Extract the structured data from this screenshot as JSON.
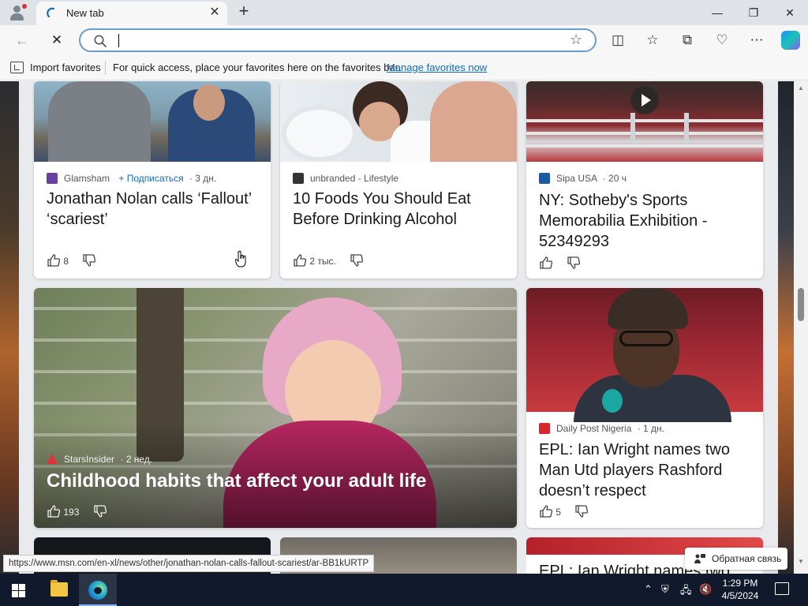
{
  "browser": {
    "tab_title": "New tab",
    "address_value": "",
    "favorites_bar": {
      "import_label": "Import favorites",
      "hint_text": "For quick access, place your favorites here on the favorites bar.",
      "manage_link": "Manage favorites now"
    },
    "status_url": "https://www.msn.com/en-xl/news/other/jonathan-nolan-calls-fallout-scariest/ar-BB1kURTP"
  },
  "feed": {
    "cards": [
      {
        "source": "Glamsham",
        "subscribe": "+ Подписаться",
        "age": "· 3 дн.",
        "title": "Jonathan Nolan calls ‘Fallout’ ‘scariest’",
        "likes": "8",
        "source_color": "#6a3fa0"
      },
      {
        "source": "unbranded - Lifestyle",
        "age": "",
        "title": "10 Foods You Should Eat Before Drinking Alcohol",
        "likes": "2 тыс.",
        "source_color": "#333333"
      },
      {
        "source": "Sipa USA",
        "age": "· 20 ч",
        "title": "NY: Sotheby's Sports Memorabilia Exhibition - 52349293",
        "likes": "",
        "source_color": "#1c5aa8"
      }
    ],
    "hero": {
      "source": "StarsInsider",
      "age": "· 2 нед.",
      "title": "Childhood habits that affect your adult life",
      "likes": "193",
      "source_color": "#e0333c"
    },
    "side": {
      "source": "Daily Post Nigeria",
      "age": "· 1 дн.",
      "title": "EPL: Ian Wright names two Man Utd players Rashford doesn’t respect",
      "likes": "5",
      "source_color": "#d7262d"
    },
    "peek_title": "EPL: Ian Wright names two",
    "feedback_label": "Обратная связь"
  },
  "taskbar": {
    "time": "1:29 PM",
    "date": "4/5/2024"
  }
}
